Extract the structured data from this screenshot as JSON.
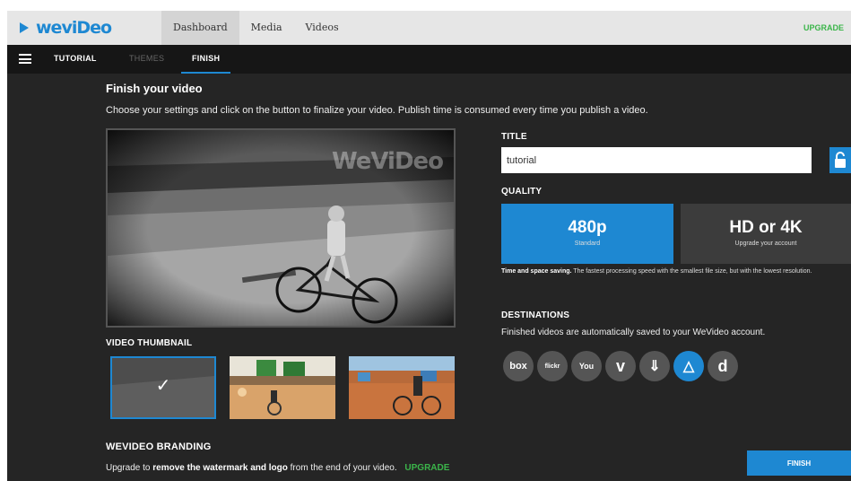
{
  "header": {
    "logo": "weviDeo",
    "nav": [
      {
        "label": "Dashboard"
      },
      {
        "label": "Media"
      },
      {
        "label": "Videos"
      }
    ],
    "upgrade": "UPGRADE"
  },
  "subnav": {
    "tabs": [
      {
        "label": "TUTORIAL"
      },
      {
        "label": "THEMES"
      },
      {
        "label": "FINISH"
      }
    ]
  },
  "main": {
    "title": "Finish your video",
    "description": "Choose your settings and click on the button to finalize your video. Publish time is consumed every time you publish a video.",
    "watermark": "WeViDeo",
    "thumbnail_label": "VIDEO THUMBNAIL",
    "branding_label": "WEVIDEO BRANDING",
    "branding_prefix": "Upgrade to",
    "branding_bold": "remove the watermark and logo",
    "branding_suffix": "from the end of your video.",
    "branding_upgrade": "UPGRADE"
  },
  "settings": {
    "title_label": "TITLE",
    "title_value": "tutorial",
    "quality_label": "QUALITY",
    "quality_options": [
      {
        "main": "480p",
        "sub": "Standard",
        "selected": true
      },
      {
        "main": "HD or 4K",
        "sub": "Upgrade your account",
        "selected": false
      }
    ],
    "quality_desc_bold": "Time and space saving.",
    "quality_desc": "The fastest processing speed with the smallest file size, but with the lowest resolution.",
    "destinations_label": "DESTINATIONS",
    "destinations_desc": "Finished videos are automatically saved to your WeVideo account.",
    "destinations": [
      {
        "name": "box",
        "label": "box"
      },
      {
        "name": "flickr",
        "label": "flickr"
      },
      {
        "name": "youtube",
        "label": "You"
      },
      {
        "name": "vimeo",
        "label": "v"
      },
      {
        "name": "dropbox",
        "label": "⇓"
      },
      {
        "name": "google-drive",
        "label": "△"
      },
      {
        "name": "dailymotion",
        "label": "d"
      }
    ],
    "finish_button": "FINISH"
  },
  "colors": {
    "accent": "#1e88d2",
    "upgrade_green": "#3bb54a",
    "background": "#252525"
  }
}
